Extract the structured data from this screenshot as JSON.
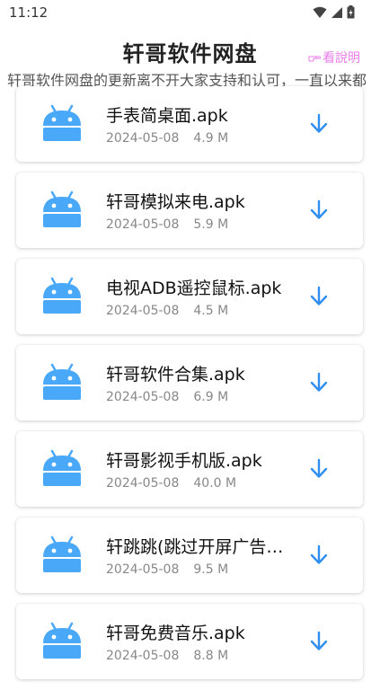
{
  "status_bar": {
    "time": "11:12"
  },
  "header": {
    "title": "轩哥软件网盘",
    "help_label": "看說明",
    "marquee": "轩哥软件网盘的更新离不开大家支持和认可，一直以来都"
  },
  "files": [
    {
      "name": "手表简桌面.apk",
      "date": "2024-05-08",
      "size": "4.9 M"
    },
    {
      "name": "轩哥模拟来电.apk",
      "date": "2024-05-08",
      "size": "5.9 M"
    },
    {
      "name": "电视ADB遥控鼠标.apk",
      "date": "2024-05-08",
      "size": "4.5 M"
    },
    {
      "name": "轩哥软件合集.apk",
      "date": "2024-05-08",
      "size": "6.9 M"
    },
    {
      "name": "轩哥影视手机版.apk",
      "date": "2024-05-08",
      "size": "40.0 M"
    },
    {
      "name": "轩跳跳(跳过开屏广告).apk",
      "date": "2024-05-08",
      "size": "9.5 M"
    },
    {
      "name": "轩哥免费音乐.apk",
      "date": "2024-05-08",
      "size": "8.8 M"
    }
  ],
  "colors": {
    "android_icon": "#4aa8f8",
    "download_arrow": "#2f8ef0",
    "help_link": "#e97ee9"
  },
  "icons": {
    "file_icon": "android-icon",
    "download": "download-arrow-icon"
  }
}
